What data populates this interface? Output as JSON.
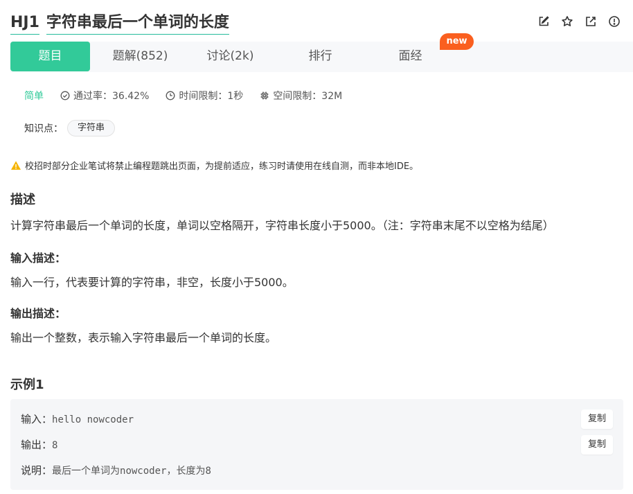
{
  "header": {
    "problem_id": "HJ1",
    "problem_title": "字符串最后一个单词的长度"
  },
  "tabs": [
    {
      "label": "题目"
    },
    {
      "label": "题解(852)"
    },
    {
      "label": "讨论(2k)"
    },
    {
      "label": "排行"
    },
    {
      "label": "面经"
    }
  ],
  "new_badge": "new",
  "meta": {
    "difficulty": "简单",
    "pass_rate": "通过率：36.42%",
    "time_limit": "时间限制：1秒",
    "space_limit": "空间限制：32M"
  },
  "knowledge": {
    "label": "知识点：",
    "tag": "字符串"
  },
  "warning": "校招时部分企业笔试将禁止编程题跳出页面，为提前适应，练习时请使用在线自测，而非本地IDE。",
  "description": {
    "title": "描述",
    "text": "计算字符串最后一个单词的长度，单词以空格隔开，字符串长度小于5000。（注：字符串末尾不以空格为结尾）"
  },
  "input_desc": {
    "title": "输入描述：",
    "text": "输入一行，代表要计算的字符串，非空，长度小于5000。"
  },
  "output_desc": {
    "title": "输出描述：",
    "text": "输出一个整数，表示输入字符串最后一个单词的长度。"
  },
  "example": {
    "title": "示例1",
    "input_label": "输入：",
    "input_value": "hello nowcoder",
    "output_label": "输出：",
    "output_value": "8",
    "explain_label": "说明：",
    "explain_value": "最后一个单词为nowcoder，长度为8",
    "copy_label": "复制"
  },
  "colors": {
    "accent": "#32ca99",
    "badge": "#fa5f1f",
    "warning_icon": "#f5b400"
  }
}
